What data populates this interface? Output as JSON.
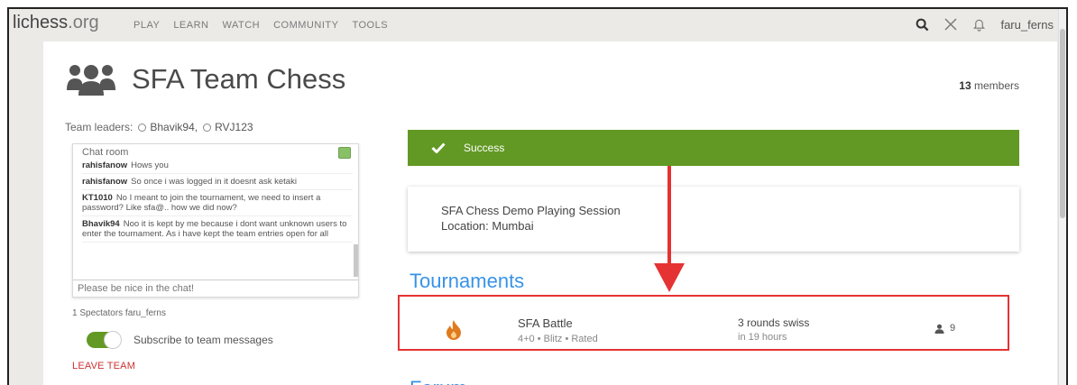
{
  "topbar": {
    "logo_main": "lichess",
    "logo_tld": ".org",
    "nav": [
      "PLAY",
      "LEARN",
      "WATCH",
      "COMMUNITY",
      "TOOLS"
    ],
    "icons": [
      "search-icon",
      "swords-icon",
      "bell-icon"
    ],
    "username": "faru_ferns"
  },
  "team": {
    "title": "SFA Team Chess",
    "members_count": "13",
    "members_label": "members",
    "leaders_label": "Team leaders:",
    "leaders": [
      "Bhavik94,",
      "RVJ123"
    ]
  },
  "chat": {
    "title": "Chat room",
    "messages": [
      {
        "user": "rahisfanow",
        "text": "Hows you"
      },
      {
        "user": "rahisfanow",
        "text": "So once i was logged in it doesnt ask ketaki"
      },
      {
        "user": "KT1010",
        "text": "No I meant to join the tournament, we need to insert a password? Like sfa@.. how we did now?"
      },
      {
        "user": "Bhavik94",
        "text": "Noo it is kept by me because i dont want unknown users to enter the tournament. As i have kept the team entries open for all"
      }
    ],
    "placeholder": "Please be nice in the chat!"
  },
  "spectators": "1 Spectators faru_ferns",
  "subscribe_label": "Subscribe to team messages",
  "subscribe_on": true,
  "leave_label": "LEAVE TEAM",
  "success_label": "Success",
  "description": {
    "line1": "SFA Chess Demo Playing Session",
    "line2": "Location: Mumbai"
  },
  "tournaments_title": "Tournaments",
  "tournament": {
    "name": "SFA Battle",
    "meta": "4+0 • Blitz • Rated",
    "format": "3 rounds swiss",
    "when": "in 19 hours",
    "players": "9"
  },
  "forum_title": "Forum",
  "colors": {
    "accent_green": "#629924",
    "link_blue": "#3893e8",
    "annotation_red": "#e53333"
  }
}
